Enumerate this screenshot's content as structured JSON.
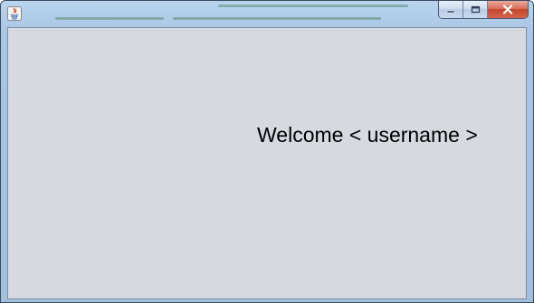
{
  "window": {
    "title": "",
    "controls": {
      "minimize": "minimize",
      "maximize": "maximize",
      "close": "close"
    },
    "app_icon": "java-icon"
  },
  "content": {
    "welcome_text": "Welcome < username >"
  },
  "colors": {
    "content_background": "#d6d9e0",
    "close_button": "#c4452d",
    "title_glass": "#a9c6e4"
  }
}
